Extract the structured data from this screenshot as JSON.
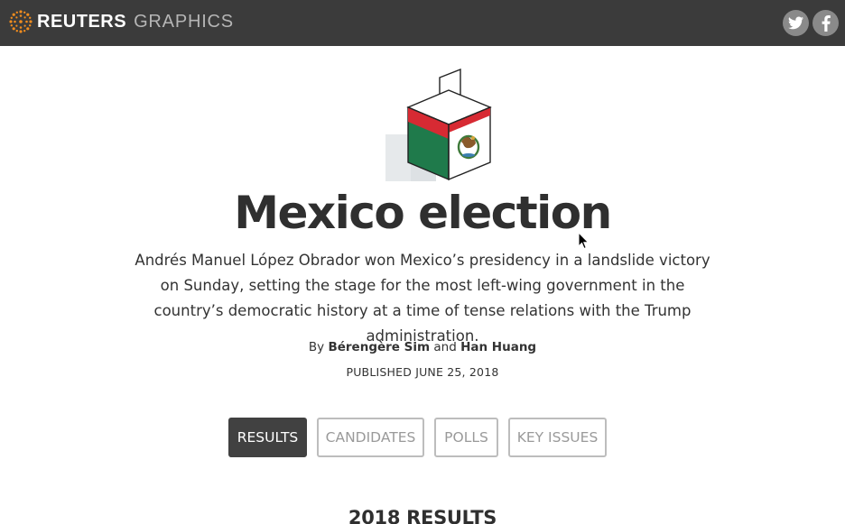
{
  "header": {
    "brand": "REUTERS",
    "brand_sub": "GRAPHICS",
    "logo_icon": "reuters-logo-icon",
    "social": [
      {
        "name": "twitter",
        "icon": "twitter-icon"
      },
      {
        "name": "facebook",
        "icon": "facebook-icon"
      }
    ],
    "colors": {
      "bar": "#3b3b3b",
      "logo": "#f08c1e",
      "social_bg": "#8a8a8a"
    }
  },
  "hero": {
    "icon": "ballot-box-icon",
    "colors": {
      "green": "#1f7a4b",
      "red": "#d72a33",
      "white": "#ffffff"
    }
  },
  "article": {
    "title": "Mexico election",
    "dek": "Andrés Manuel López Obrador won Mexico’s presidency in a landslide victory on Sunday, setting the stage for the most left-wing government in the country’s democratic history at a time of tense relations with the Trump administration.",
    "byline_prefix": "By",
    "author1": "Bérengère Sim",
    "byline_and": "and",
    "author2": "Han Huang",
    "published": "PUBLISHED JUNE 25, 2018"
  },
  "tabs": [
    {
      "label": "RESULTS",
      "active": true
    },
    {
      "label": "CANDIDATES",
      "active": false
    },
    {
      "label": "POLLS",
      "active": false
    },
    {
      "label": "KEY ISSUES",
      "active": false
    }
  ],
  "section": {
    "title": "2018 RESULTS"
  }
}
